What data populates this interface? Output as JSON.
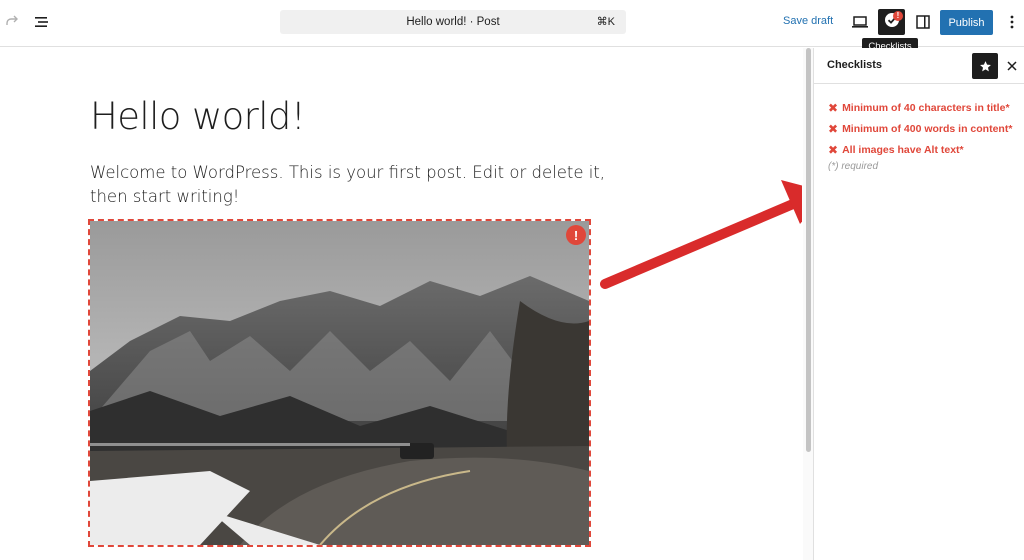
{
  "topbar": {
    "command_bar_text": "Hello world! · Post",
    "command_shortcut": "⌘K",
    "save_draft_label": "Save draft",
    "publish_label": "Publish",
    "checklist_badge": "!",
    "tooltip": "Checklists",
    "icons": {
      "redo": "redo-icon",
      "document_overview": "list-view-icon",
      "preview": "laptop-icon",
      "checklists": "checklist-icon",
      "settings": "sidebar-toggle-icon",
      "options": "more-vertical-icon"
    }
  },
  "post": {
    "title": "Hello world!",
    "paragraph": "Welcome to WordPress. This is your first post. Edit or delete it, then start writing!",
    "image_warning": "!"
  },
  "sidebar": {
    "title": "Checklists",
    "items": [
      {
        "mark": "✖",
        "label": "Minimum of 40 characters in title*"
      },
      {
        "mark": "✖",
        "label": "Minimum of 400 words in content*"
      },
      {
        "mark": "✖",
        "label": "All images have Alt text*"
      }
    ],
    "required_note": "(*) required"
  },
  "colors": {
    "accent": "#2271b1",
    "error": "#e0473a",
    "dark": "#1e1e1e"
  }
}
